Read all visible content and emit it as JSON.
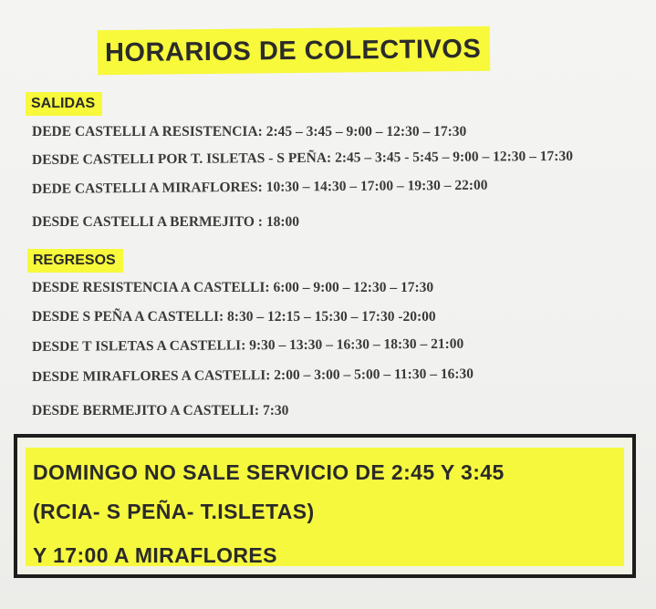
{
  "title": "HORARIOS DE COLECTIVOS",
  "salidas": {
    "label": "SALIDAS",
    "lines": [
      "DEDE CASTELLI A RESISTENCIA: 2:45 – 3:45 – 9:00 – 12:30 – 17:30",
      "DESDE CASTELLI POR T. ISLETAS - S PEÑA: 2:45 – 3:45 - 5:45 – 9:00 – 12:30 – 17:30",
      "DEDE CASTELLI A MIRAFLORES: 10:30 – 14:30 – 17:00 – 19:30 – 22:00",
      "DESDE CASTELLI A BERMEJITO : 18:00"
    ]
  },
  "regresos": {
    "label": "REGRESOS",
    "lines": [
      "DESDE RESISTENCIA A CASTELLI: 6:00 – 9:00 – 12:30 – 17:30",
      "DESDE S PEÑA A CASTELLI: 8:30 – 12:15 – 15:30 – 17:30 -20:00",
      "DESDE T ISLETAS A CASTELLI: 9:30 – 13:30 – 16:30 – 18:30 – 21:00",
      "DESDE MIRAFLORES A CASTELLI: 2:00 – 3:00 – 5:00 – 11:30 – 16:30",
      "DESDE BERMEJITO A CASTELLI: 7:30"
    ]
  },
  "notice": {
    "lines": [
      "DOMINGO NO SALE SERVICIO DE 2:45 Y 3:45",
      "(RCIA- S PEÑA- T.ISLETAS)",
      "Y 17:00 A MIRAFLORES"
    ]
  }
}
